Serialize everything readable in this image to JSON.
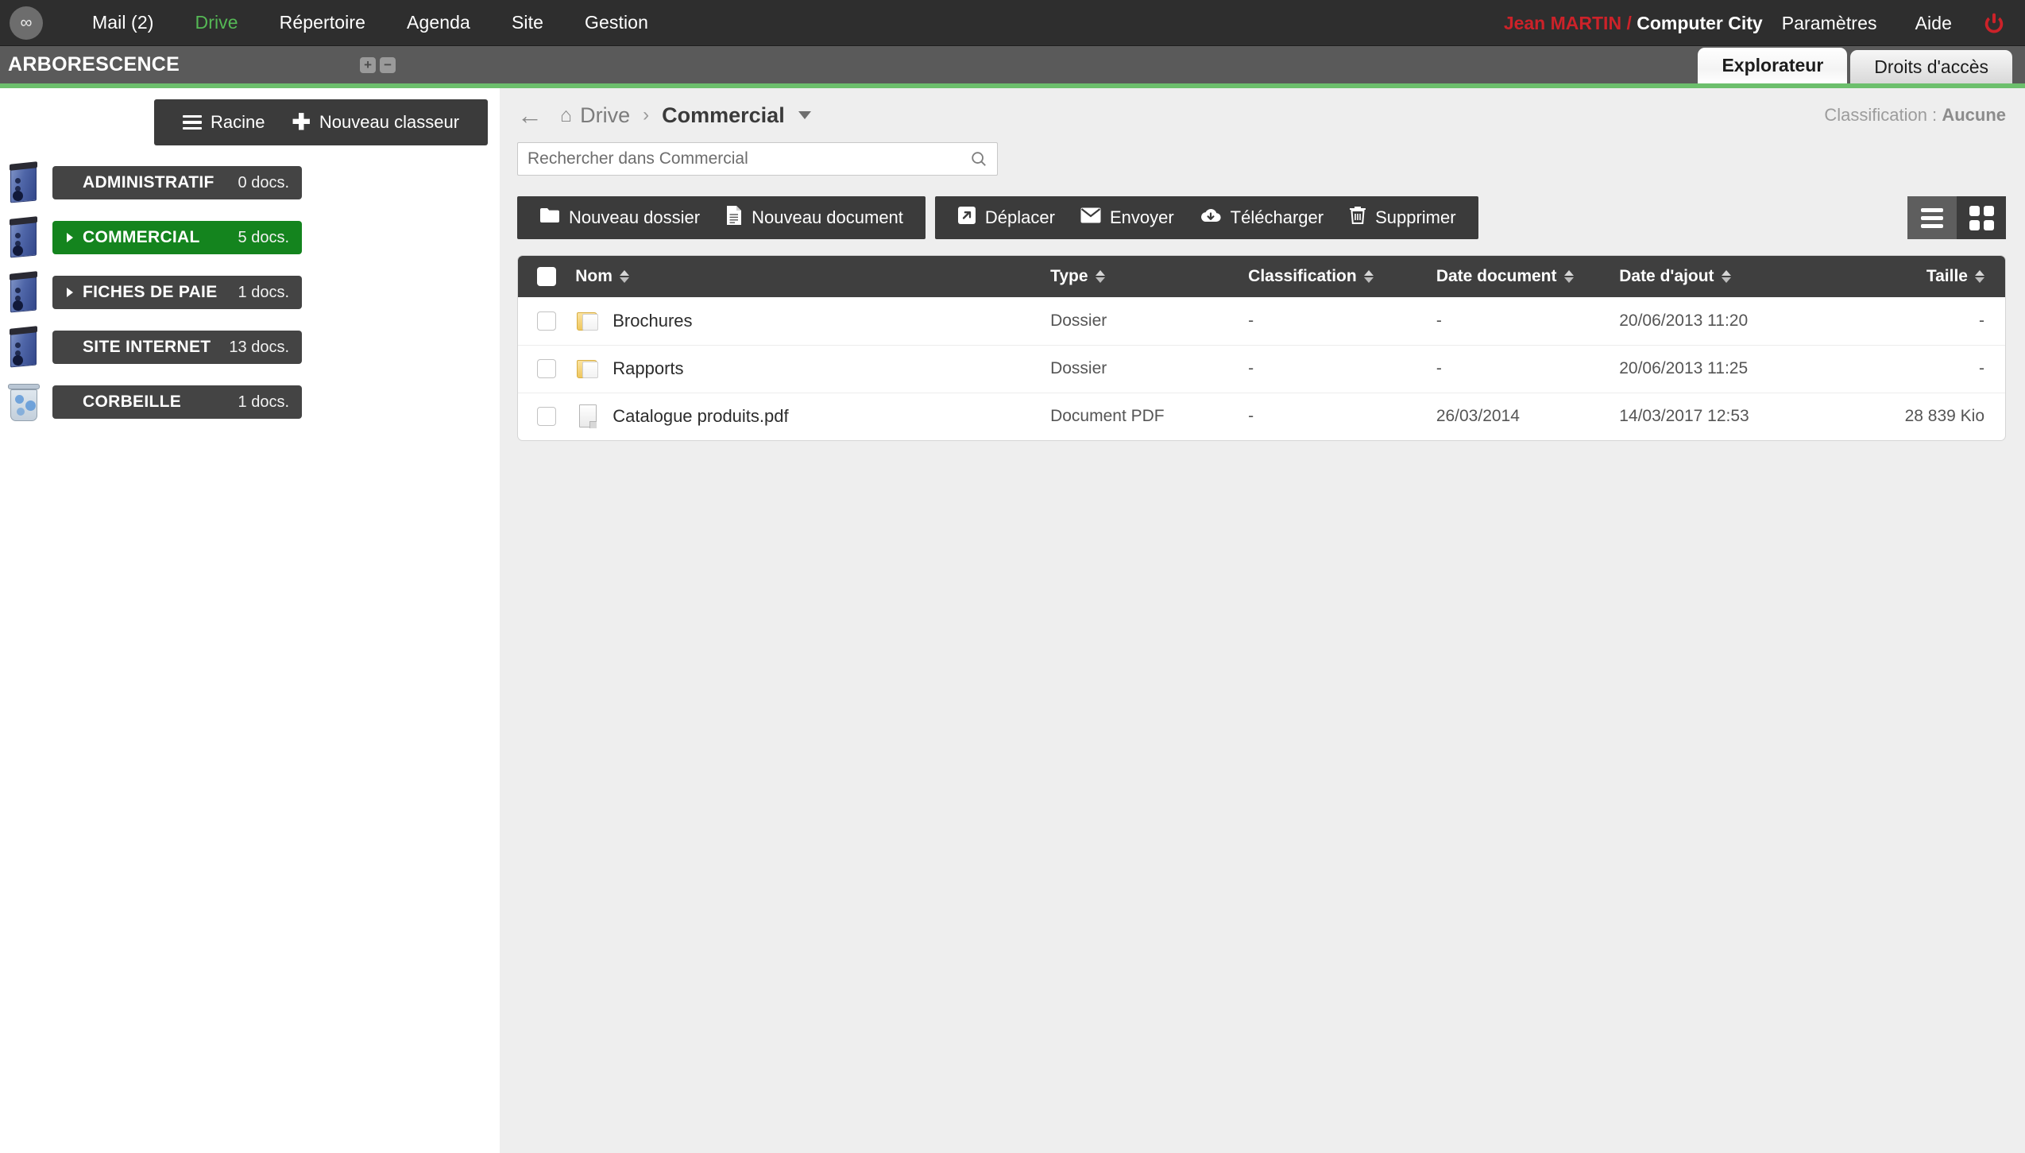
{
  "topnav": {
    "logo_icon": "infinity-logo-icon",
    "items": [
      {
        "label": "Mail (2)",
        "active": false
      },
      {
        "label": "Drive",
        "active": true
      },
      {
        "label": "Répertoire",
        "active": false
      },
      {
        "label": "Agenda",
        "active": false
      },
      {
        "label": "Site",
        "active": false
      },
      {
        "label": "Gestion",
        "active": false
      }
    ],
    "user_name": "Jean MARTIN /",
    "user_org": "Computer City",
    "settings_label": "Paramètres",
    "help_label": "Aide",
    "logout_icon": "power-icon",
    "accent_red": "#cc2229",
    "accent_green": "#55b855"
  },
  "subbar": {
    "title": "ARBORESCENCE",
    "expand_label": "+",
    "collapse_label": "−",
    "tabs": [
      {
        "label": "Explorateur",
        "active": true
      },
      {
        "label": "Droits d'accès",
        "active": false
      }
    ],
    "accent_line_color": "#6cbf6c"
  },
  "sidebar": {
    "actions": {
      "root_label": "Racine",
      "new_binder_label": "Nouveau classeur"
    },
    "items": [
      {
        "label": "ADMINISTRATIF",
        "count": "0 docs.",
        "icon": "binder-icon",
        "expandable": false,
        "selected": false
      },
      {
        "label": "COMMERCIAL",
        "count": "5 docs.",
        "icon": "binder-icon",
        "expandable": true,
        "selected": true
      },
      {
        "label": "FICHES DE PAIE",
        "count": "1 docs.",
        "icon": "binder-icon",
        "expandable": true,
        "selected": false
      },
      {
        "label": "SITE INTERNET",
        "count": "13 docs.",
        "icon": "binder-icon",
        "expandable": false,
        "selected": false
      },
      {
        "label": "CORBEILLE",
        "count": "1 docs.",
        "icon": "trash-icon",
        "expandable": false,
        "selected": false
      }
    ],
    "selected_color": "#14841e"
  },
  "content": {
    "breadcrumb": {
      "back_icon": "back-arrow-icon",
      "home_icon": "home-icon",
      "root": "Drive",
      "separator": "›",
      "current": "Commercial",
      "dropdown_icon": "chevron-down-icon"
    },
    "classification": {
      "label": "Classification :",
      "value": "Aucune"
    },
    "search": {
      "value": "",
      "placeholder": "Rechercher dans Commercial",
      "icon": "search-icon"
    },
    "toolbar": {
      "group1": [
        {
          "label": "Nouveau dossier",
          "icon": "folder-icon"
        },
        {
          "label": "Nouveau document",
          "icon": "document-icon"
        }
      ],
      "group2": [
        {
          "label": "Déplacer",
          "icon": "move-arrow-icon"
        },
        {
          "label": "Envoyer",
          "icon": "envelope-icon"
        },
        {
          "label": "Télécharger",
          "icon": "cloud-download-icon"
        },
        {
          "label": "Supprimer",
          "icon": "trash-icon"
        }
      ],
      "view_list_icon": "list-view-icon",
      "view_grid_icon": "grid-view-icon",
      "view_active": "grid"
    },
    "table": {
      "columns": [
        {
          "key": "checkbox",
          "label": ""
        },
        {
          "key": "nom",
          "label": "Nom",
          "sortable": true
        },
        {
          "key": "type",
          "label": "Type",
          "sortable": true
        },
        {
          "key": "classification",
          "label": "Classification",
          "sortable": true
        },
        {
          "key": "date_document",
          "label": "Date document",
          "sortable": true
        },
        {
          "key": "date_ajout",
          "label": "Date d'ajout",
          "sortable": true
        },
        {
          "key": "taille",
          "label": "Taille",
          "sortable": true
        }
      ],
      "rows": [
        {
          "icon": "folder-icon",
          "nom": "Brochures",
          "type": "Dossier",
          "classification": "-",
          "date_document": "-",
          "date_ajout": "20/06/2013 11:20",
          "taille": "-",
          "checked": false
        },
        {
          "icon": "folder-icon",
          "nom": "Rapports",
          "type": "Dossier",
          "classification": "-",
          "date_document": "-",
          "date_ajout": "20/06/2013 11:25",
          "taille": "-",
          "checked": false
        },
        {
          "icon": "pdf-document-icon",
          "nom": "Catalogue produits.pdf",
          "type": "Document PDF",
          "classification": "-",
          "date_document": "26/03/2014",
          "date_ajout": "14/03/2017 12:53",
          "taille": "28 839 Kio",
          "checked": false
        }
      ]
    }
  }
}
